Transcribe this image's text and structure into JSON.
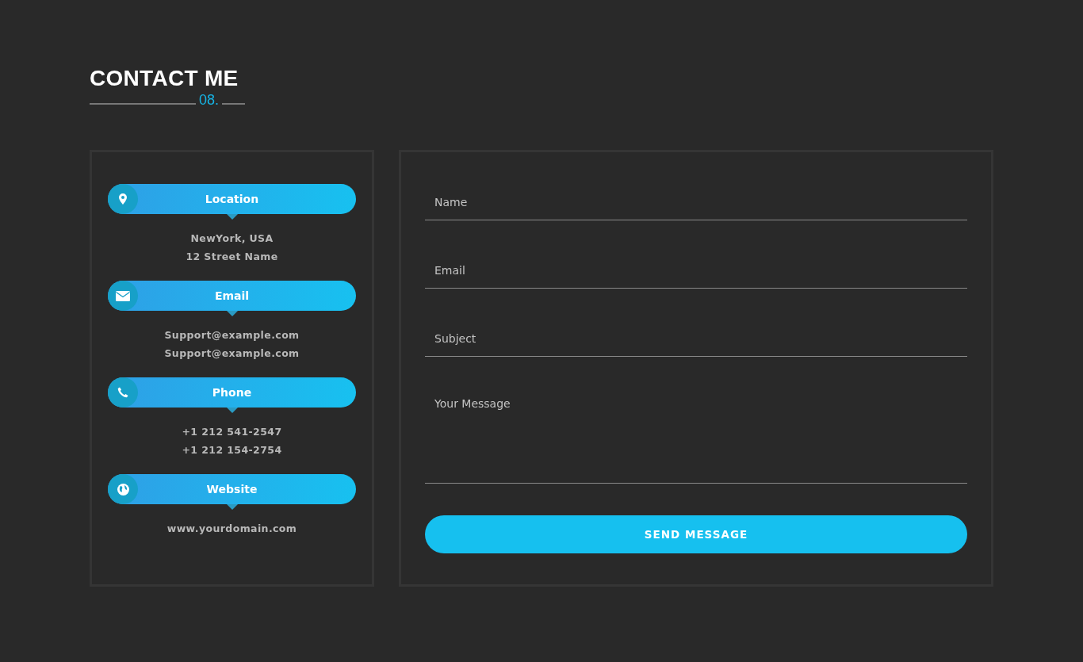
{
  "heading": {
    "title": "CONTACT ME",
    "number": "08."
  },
  "contact_items": [
    {
      "kind": "location",
      "label": "Location",
      "lines": [
        "NewYork, USA",
        "12 Street Name"
      ]
    },
    {
      "kind": "email",
      "label": "Email",
      "lines": [
        "Support@example.com",
        "Support@example.com"
      ]
    },
    {
      "kind": "phone",
      "label": "Phone",
      "lines": [
        "+1 212 541-2547",
        "+1 212 154-2754"
      ]
    },
    {
      "kind": "website",
      "label": "Website",
      "lines": [
        "www.yourdomain.com"
      ]
    }
  ],
  "form": {
    "fields": [
      {
        "kind": "input",
        "placeholder": "Name"
      },
      {
        "kind": "input",
        "placeholder": "Email"
      },
      {
        "kind": "input",
        "placeholder": "Subject"
      },
      {
        "kind": "textarea",
        "placeholder": "Your Message"
      }
    ],
    "submit": "SEND MESSAGE"
  }
}
